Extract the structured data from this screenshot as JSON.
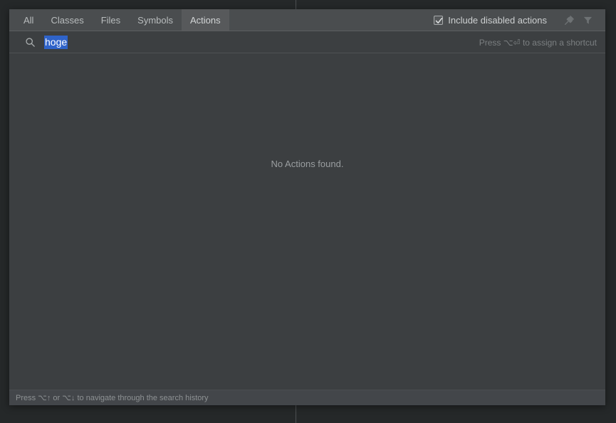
{
  "popup": {
    "tabs": [
      {
        "label": "All",
        "active": false
      },
      {
        "label": "Classes",
        "active": false
      },
      {
        "label": "Files",
        "active": false
      },
      {
        "label": "Symbols",
        "active": false
      },
      {
        "label": "Actions",
        "active": true
      }
    ],
    "toolbar": {
      "include_disabled_label": "Include disabled actions",
      "include_disabled_checked": true,
      "pin_icon": "pin-icon",
      "filter_icon": "filter-icon"
    },
    "search": {
      "icon": "search-icon",
      "value": "hoge",
      "placeholder": "",
      "selected": true,
      "hint": "Press ⌥⏎ to assign a shortcut"
    },
    "results": {
      "empty_message": "No Actions found."
    },
    "status": {
      "text": "Press ⌥↑ or ⌥↓ to navigate through the search history"
    }
  },
  "colors": {
    "popup_background": "#3c3f41",
    "tabbar_background": "#4a4d4f",
    "active_tab_background": "#57595b",
    "selection_blue": "#2f63c9",
    "statusbar_background": "#43464a",
    "backdrop": "#252829"
  }
}
